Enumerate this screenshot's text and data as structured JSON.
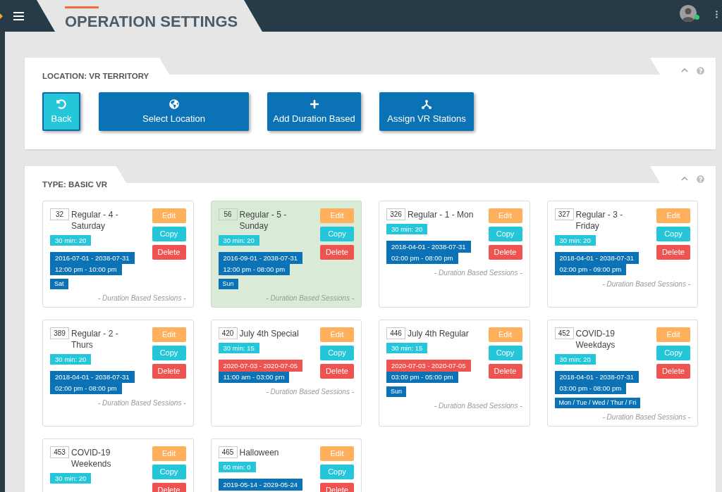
{
  "top_bar": {
    "title": "OPERATION SETTINGS"
  },
  "location_panel": {
    "title": "LOCATION: VR TERRITORY",
    "buttons": [
      {
        "label": "Back",
        "kind": "back"
      },
      {
        "label": "Select Location",
        "kind": "location"
      },
      {
        "label": "Add Duration Based",
        "kind": "add"
      },
      {
        "label": "Assign VR Stations",
        "kind": "assign"
      }
    ]
  },
  "type_panel": {
    "title": "TYPE: BASIC VR",
    "cards": [
      {
        "id": "32",
        "name": "Regular - 4 - Saturday",
        "selected": false,
        "rate": "30 min: 20",
        "dates": {
          "text": "2016-07-01 - 2038-07-31",
          "color": "#0b72b5"
        },
        "hours": "12:00 pm - 10:00 pm",
        "days": "Sat",
        "actions": [
          {
            "label": "Edit",
            "kind": "edit"
          },
          {
            "label": "Copy",
            "kind": "copy"
          },
          {
            "label": "Delete",
            "kind": "delete"
          }
        ],
        "footer": "- Duration Based Sessions -"
      },
      {
        "id": "56",
        "name": "Regular - 5 - Sunday",
        "selected": true,
        "rate": "30 min: 20",
        "dates": {
          "text": "2016-09-01 - 2038-07-31",
          "color": "#0b72b5"
        },
        "hours": "12:00 pm - 08:00 pm",
        "days": "Sun",
        "actions": [
          {
            "label": "Edit",
            "kind": "edit"
          },
          {
            "label": "Copy",
            "kind": "copy"
          },
          {
            "label": "Delete",
            "kind": "delete"
          }
        ],
        "footer": "- Duration Based Sessions -"
      },
      {
        "id": "326",
        "name": "Regular - 1 - Mon",
        "selected": false,
        "rate": "30 min: 20",
        "dates": {
          "text": "2018-04-01 - 2038-07-31",
          "color": "#0b72b5"
        },
        "hours": "02:00 pm - 08:00 pm",
        "actions": [
          {
            "label": "Edit",
            "kind": "edit"
          },
          {
            "label": "Copy",
            "kind": "copy"
          },
          {
            "label": "Delete",
            "kind": "delete"
          }
        ],
        "footer": "- Duration Based Sessions -"
      },
      {
        "id": "327",
        "name": "Regular - 3 - Friday",
        "selected": false,
        "rate": "30 min: 20",
        "dates": {
          "text": "2018-04-01 - 2038-07-31",
          "color": "#0b72b5"
        },
        "hours": "02:00 pm - 09:00 pm",
        "actions": [
          {
            "label": "Edit",
            "kind": "edit"
          },
          {
            "label": "Copy",
            "kind": "copy"
          },
          {
            "label": "Delete",
            "kind": "delete"
          }
        ],
        "footer": "- Duration Based Sessions -"
      },
      {
        "id": "389",
        "name": "Regular - 2 - Thurs",
        "selected": false,
        "rate": "30 min: 20",
        "dates": {
          "text": "2018-04-01 - 2038-07-31",
          "color": "#0b72b5"
        },
        "hours": "02:00 pm - 08:00 pm",
        "actions": [
          {
            "label": "Edit",
            "kind": "edit"
          },
          {
            "label": "Copy",
            "kind": "copy"
          },
          {
            "label": "Delete",
            "kind": "delete"
          }
        ],
        "footer": "- Duration Based Sessions -"
      },
      {
        "id": "420",
        "name": "July 4th Special",
        "selected": false,
        "rate": "30 min: 15",
        "dates": {
          "text": "2020-07-03 - 2020-07-05",
          "color": "#ef5350"
        },
        "hours": "11:00 am - 03:00 pm",
        "actions": [
          {
            "label": "Edit",
            "kind": "edit"
          },
          {
            "label": "Copy",
            "kind": "copy"
          },
          {
            "label": "Delete",
            "kind": "delete"
          }
        ],
        "footer": "- Duration Based Sessions -"
      },
      {
        "id": "446",
        "name": "July 4th Regular",
        "selected": false,
        "rate": "30 min: 15",
        "dates": {
          "text": "2020-07-03 - 2020-07-05",
          "color": "#ef5350"
        },
        "hours": "03:00 pm - 05:00 pm",
        "days": "Sun",
        "actions": [
          {
            "label": "Edit",
            "kind": "edit"
          },
          {
            "label": "Copy",
            "kind": "copy"
          },
          {
            "label": "Delete",
            "kind": "delete"
          }
        ],
        "footer": "- Duration Based Sessions -"
      },
      {
        "id": "452",
        "name": "COVID-19 Weekdays",
        "selected": false,
        "rate": "30 min: 20",
        "dates": {
          "text": "2018-04-01 - 2038-07-31",
          "color": "#0b72b5"
        },
        "hours": "03:00 pm - 08:00 pm",
        "days": "Mon / Tue / Wed / Thur / Fri",
        "actions": [
          {
            "label": "Edit",
            "kind": "edit"
          },
          {
            "label": "Copy",
            "kind": "copy"
          },
          {
            "label": "Delete",
            "kind": "delete"
          }
        ],
        "footer": "- Duration Based Sessions -"
      },
      {
        "id": "453",
        "name": "COVID-19 Weekends",
        "selected": false,
        "rate": "30 min: 20",
        "actions": [
          {
            "label": "Edit",
            "kind": "edit"
          },
          {
            "label": "Copy",
            "kind": "copy"
          },
          {
            "label": "Delete",
            "kind": "delete"
          }
        ]
      },
      {
        "id": "465",
        "name": "Halloween",
        "selected": false,
        "rate": "60 min: 0",
        "dates": {
          "text": "2019-05-14 - 2029-05-24",
          "color": "#0b72b5"
        },
        "actions": [
          {
            "label": "Edit",
            "kind": "edit"
          },
          {
            "label": "Copy",
            "kind": "copy"
          },
          {
            "label": "Delete",
            "kind": "delete"
          }
        ]
      }
    ]
  }
}
